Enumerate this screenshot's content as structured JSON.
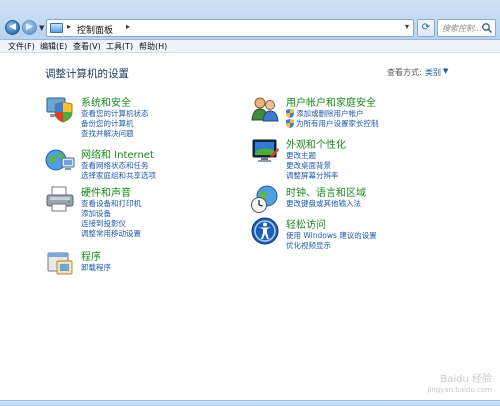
{
  "window": {
    "address_path": "控制面板",
    "search_placeholder": "搜索控制..."
  },
  "menu": [
    "文件(F)",
    "编辑(E)",
    "查看(V)",
    "工具(T)",
    "帮助(H)"
  ],
  "main": {
    "heading": "调整计算机的设置",
    "view_by_label": "查看方式:",
    "view_by_value": "类别"
  },
  "categories": [
    {
      "id": "system-security",
      "icon": "shield-computer-icon",
      "title": "系统和安全",
      "links": [
        "查看您的计算机状态",
        "备份您的计算机",
        "查找并解决问题"
      ]
    },
    {
      "id": "network",
      "icon": "network-globe-icon",
      "title": "网络和 Internet",
      "links": [
        "查看网络状态和任务",
        "选择家庭组和共享选项"
      ]
    },
    {
      "id": "hardware-sound",
      "icon": "printer-icon",
      "title": "硬件和声音",
      "links": [
        "查看设备和打印机",
        "添加设备",
        "连接到投影仪",
        "调整常用移动设置"
      ]
    },
    {
      "id": "programs",
      "icon": "programs-icon",
      "title": "程序",
      "links": [
        "卸载程序"
      ]
    },
    {
      "id": "user-accounts",
      "icon": "users-icon",
      "title": "用户帐户和家庭安全",
      "links": [
        "添加或删除用户帐户",
        "为所有用户设置家长控制"
      ]
    },
    {
      "id": "appearance",
      "icon": "monitor-icon",
      "title": "外观和个性化",
      "links": [
        "更改主题",
        "更改桌面背景",
        "调整屏幕分辨率"
      ]
    },
    {
      "id": "clock-region",
      "icon": "clock-globe-icon",
      "title": "时钟、语言和区域",
      "links": [
        "更改键盘或其他输入法"
      ]
    },
    {
      "id": "ease-of-access",
      "icon": "ease-of-access-icon",
      "title": "轻松访问",
      "links": [
        "使用 Windows 建议的设置",
        "优化视频显示"
      ]
    }
  ],
  "watermark": {
    "line1": "Baidu 经验",
    "line2": "jingyan.baidu.com"
  }
}
